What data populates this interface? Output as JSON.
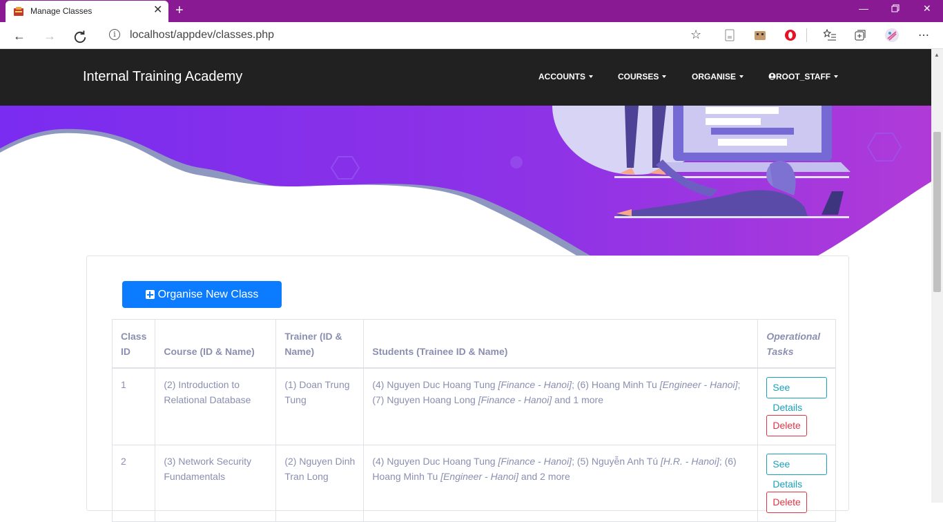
{
  "browser": {
    "tab_title": "Manage Classes",
    "url": "localhost/appdev/classes.php",
    "new_tab": "+",
    "close_tab": "✕"
  },
  "site": {
    "brand": "Internal Training Academy",
    "menu": [
      "ACCOUNTS",
      "COURSES",
      "ORGANISE",
      "ROOT_STAFF"
    ]
  },
  "actions": {
    "organise_new_class": "Organise New Class"
  },
  "table": {
    "headers": {
      "class_id": "Class ID",
      "course": "Course (ID & Name)",
      "trainer": "Trainer (ID & Name)",
      "students": "Students (Trainee ID & Name)",
      "tasks": "Operational Tasks"
    },
    "rows": [
      {
        "id": "1",
        "course": "(2) Introduction to Relational Database",
        "trainer": "(1) Doan Trung Tung",
        "students": [
          {
            "name": "(4) Nguyen Duc Hoang Tung ",
            "dept": "[Finance - Hanoi]",
            "sep": "; "
          },
          {
            "name": "(6) Hoang Minh Tu ",
            "dept": "[Engineer - Hanoi]",
            "sep": "; "
          },
          {
            "name": "(7) Nguyen Hoang Long ",
            "dept": "[Finance - Hanoi]",
            "sep": ""
          }
        ],
        "more": " and 1 more",
        "details": "See Details",
        "delete": "Delete"
      },
      {
        "id": "2",
        "course": "(3) Network Security Fundamentals",
        "trainer": "(2) Nguyen Dinh Tran Long",
        "students": [
          {
            "name": "(4) Nguyen Duc Hoang Tung ",
            "dept": "[Finance - Hanoi]",
            "sep": "; "
          },
          {
            "name": "(5) Nguyễn Anh Tú ",
            "dept": "[H.R. - Hanoi]",
            "sep": "; "
          },
          {
            "name": "(6) Hoang Minh Tu ",
            "dept": "[Engineer - Hanoi]",
            "sep": ""
          }
        ],
        "more": " and 2 more",
        "details": "See Details",
        "delete": "Delete"
      }
    ]
  },
  "colors": {
    "browser_chrome": "#8a1a94",
    "header": "#212121",
    "hero_purple": "#8b2fe0",
    "primary": "#0b7cff",
    "info": "#17a2b8",
    "danger": "#dc3545",
    "table_text": "#8a8fb0"
  }
}
